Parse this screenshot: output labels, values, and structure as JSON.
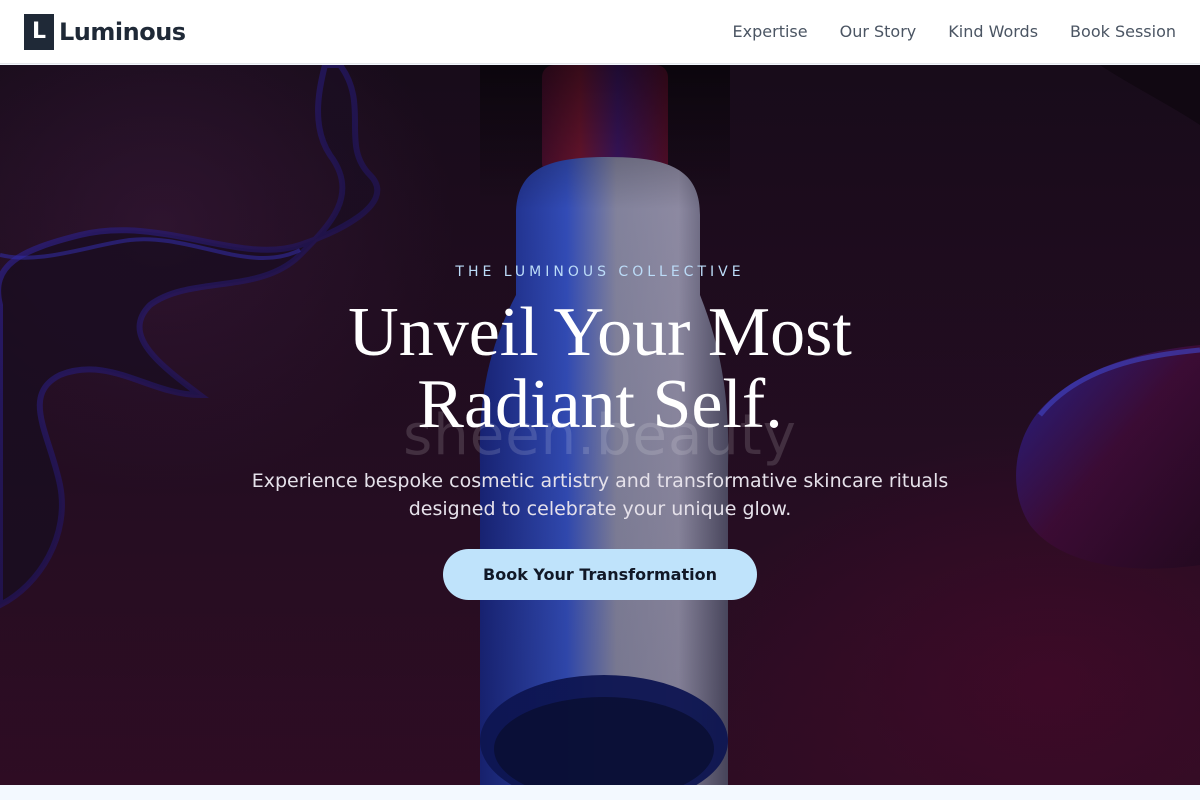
{
  "brand": {
    "mark": "L",
    "name": "Luminous"
  },
  "nav": {
    "links": [
      {
        "label": "Expertise"
      },
      {
        "label": "Our Story"
      },
      {
        "label": "Kind Words"
      },
      {
        "label": "Book Session"
      }
    ]
  },
  "hero": {
    "eyebrow": "THE LUMINOUS COLLECTIVE",
    "headline_line1": "Unveil Your Most",
    "headline_line2": "Radiant Self.",
    "subtitle": "Experience bespoke cosmetic artistry and transformative skincare rituals designed to celebrate your unique glow.",
    "cta_label": "Book Your Transformation",
    "watermark": "sheen.beauty"
  },
  "colors": {
    "accent": "#bfe3fb",
    "brand_dark": "#1f2937",
    "eyebrow": "#bcdcf8"
  }
}
